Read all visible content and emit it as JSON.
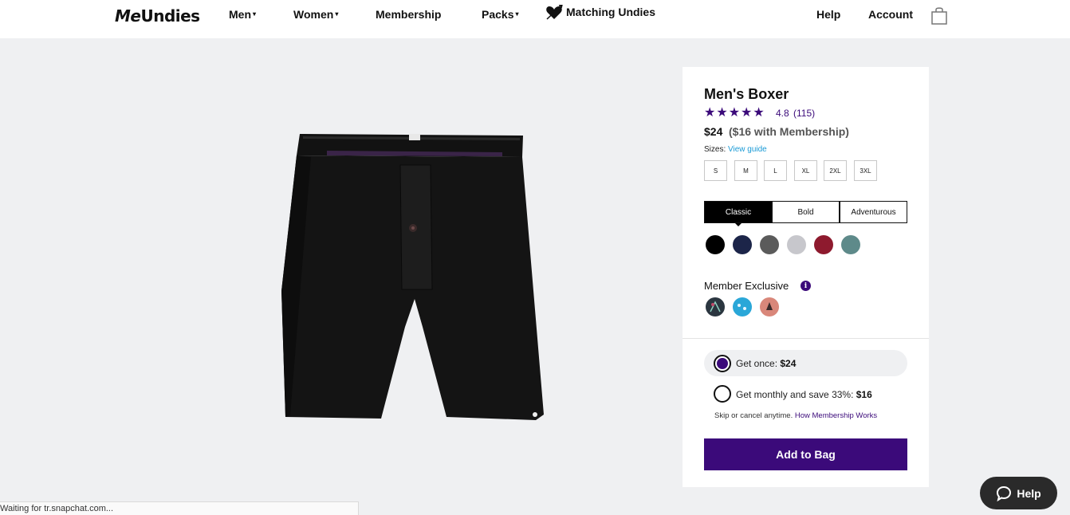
{
  "header": {
    "logo_me": "Me",
    "logo_undies": "Undies",
    "nav": {
      "men": "Men",
      "women": "Women",
      "membership": "Membership",
      "packs": "Packs",
      "matching": "Matching Undies",
      "help": "Help",
      "account": "Account"
    }
  },
  "product": {
    "title": "Men's Boxer",
    "stars": 5,
    "rating": "4.8",
    "reviews": "(115)",
    "price": "$24",
    "price_member": "($16 with Membership)",
    "sizes_label": "Sizes:",
    "view_guide": "View guide",
    "sizes": [
      "S",
      "M",
      "L",
      "XL",
      "2XL",
      "3XL"
    ],
    "tabs": [
      "Classic",
      "Bold",
      "Adventurous"
    ],
    "active_tab": "Classic",
    "colors": [
      "#000000",
      "#1c2549",
      "#5b5b5b",
      "#c7c7cc",
      "#8e1a2e",
      "#5e8a8a"
    ],
    "member_exclusive_label": "Member Exclusive",
    "member_swatches": [
      "#2b3640",
      "#2aa7d8",
      "#d9877a"
    ]
  },
  "purchase": {
    "once_label": "Get once: ",
    "once_price": "$24",
    "monthly_label": "Get monthly and save 33%: ",
    "monthly_price": "$16",
    "skip_text": "Skip or cancel anytime. ",
    "how_link": "How Membership Works",
    "add_button": "Add to Bag"
  },
  "help_button": "Help",
  "status_bar": "Waiting for tr.snapchat.com..."
}
